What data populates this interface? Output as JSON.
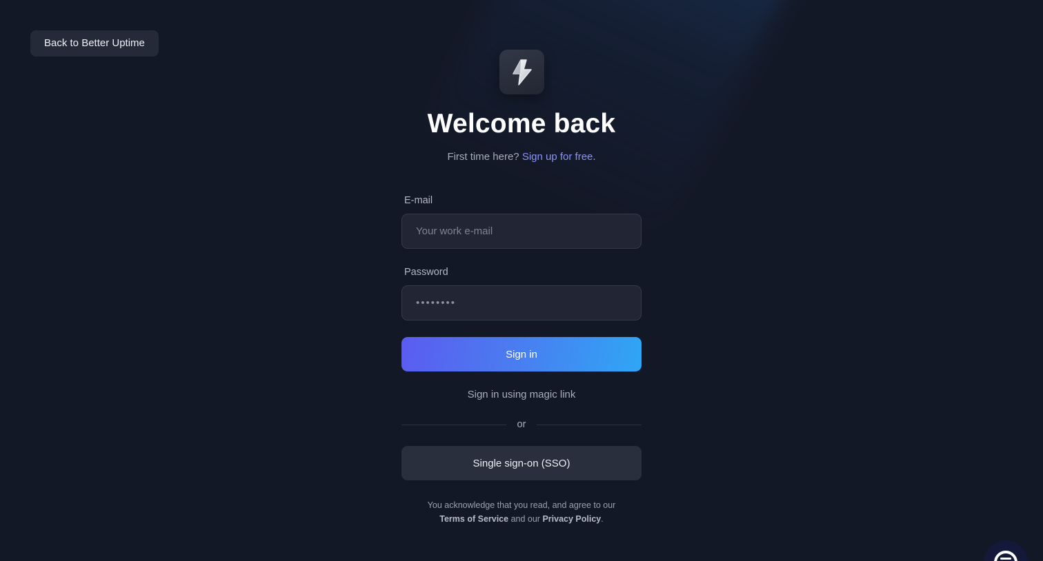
{
  "nav": {
    "back_label": "Back to Better Uptime"
  },
  "header": {
    "title": "Welcome back",
    "subtitle_prefix": "First time here?",
    "signup_link": "Sign up for free",
    "subtitle_suffix": "."
  },
  "form": {
    "email_label": "E-mail",
    "email_placeholder": "Your work e-mail",
    "password_label": "Password",
    "password_placeholder": "••••••••",
    "signin_label": "Sign in",
    "magic_link_label": "Sign in using magic link",
    "divider_label": "or",
    "sso_label": "Single sign-on (SSO)"
  },
  "legal": {
    "line1": "You acknowledge that you read, and agree to our",
    "terms_link": "Terms of Service",
    "middle": "and our",
    "privacy_link": "Privacy Policy",
    "end": "."
  },
  "icons": {
    "logo": "lightning-bolt-icon",
    "chat": "chat-icon"
  },
  "colors": {
    "background": "#131826",
    "accent_link": "#8b93f5",
    "button_gradient_start": "#5b5cf0",
    "button_gradient_end": "#2fa6f5"
  }
}
